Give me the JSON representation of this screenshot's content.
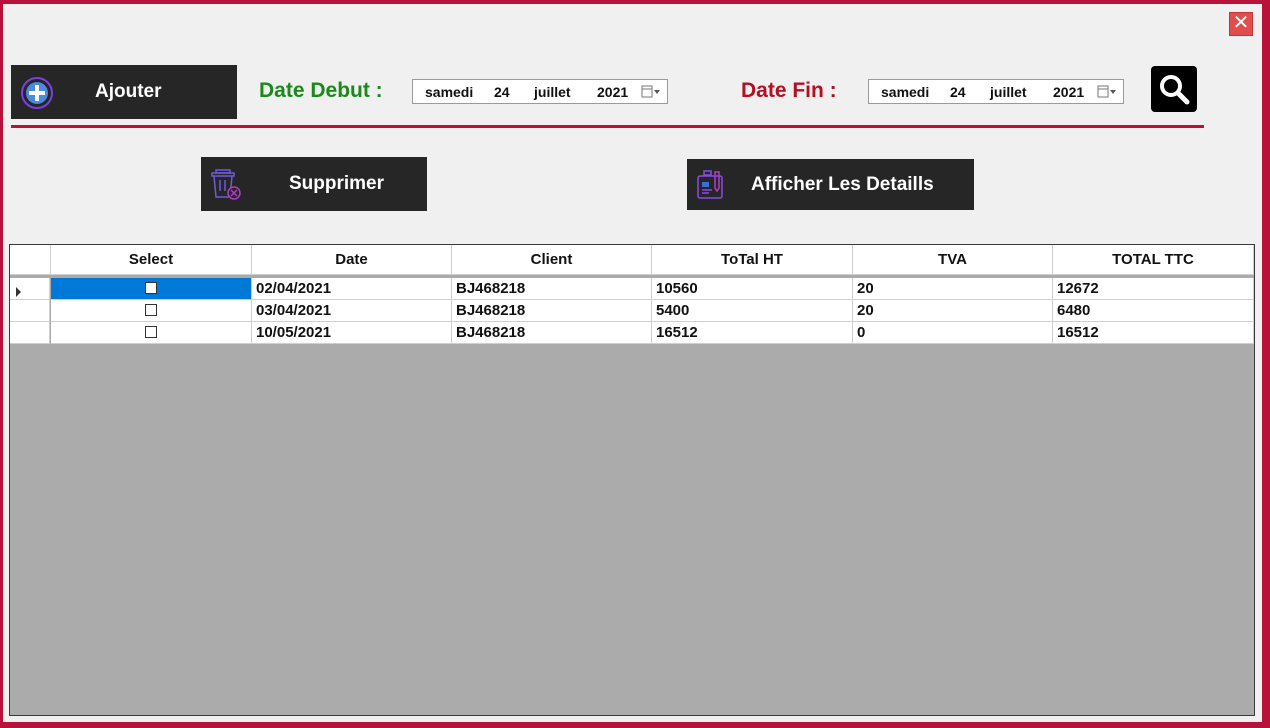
{
  "window": {
    "close_glyph": "✕"
  },
  "toolbar": {
    "add_label": "Ajouter",
    "date_debut_label": "Date Debut :",
    "date_fin_label": "Date Fin :",
    "date_debut": {
      "day_name": "samedi",
      "day": "24",
      "month": "juillet",
      "year": "2021"
    },
    "date_fin": {
      "day_name": "samedi",
      "day": "24",
      "month": "juillet",
      "year": "2021"
    }
  },
  "actions": {
    "delete_label": "Supprimer",
    "details_label": "Afficher Les Detaills"
  },
  "colors": {
    "frame": "#b8123a",
    "debut_label": "#1b8a1b",
    "fin_label": "#b30f22",
    "button_bg": "#262626",
    "icon_purple": "#7b3fe4",
    "selection": "#0078d7"
  },
  "grid": {
    "columns": [
      "Select",
      "Date",
      "Client",
      "ToTal HT",
      "TVA",
      "TOTAL TTC"
    ],
    "rows": [
      {
        "checked": false,
        "date": "02/04/2021",
        "client": "BJ468218",
        "total_ht": "10560",
        "tva": "20",
        "total_ttc": "12672"
      },
      {
        "checked": false,
        "date": "03/04/2021",
        "client": "BJ468218",
        "total_ht": "5400",
        "tva": "20",
        "total_ttc": "6480"
      },
      {
        "checked": false,
        "date": "10/05/2021",
        "client": "BJ468218",
        "total_ht": "16512",
        "tva": "0",
        "total_ttc": "16512"
      }
    ]
  }
}
